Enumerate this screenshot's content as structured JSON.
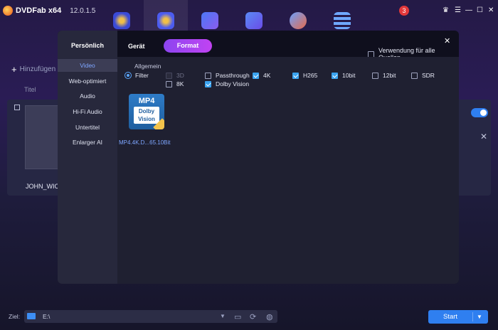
{
  "app": {
    "name": "DVDFab x64",
    "version": "12.0.1.5"
  },
  "top_icons": [
    "copy-disc-icon",
    "ripper-disc-icon",
    "video-converter-icon",
    "creator-icon",
    "utilities-rocket-icon",
    "task-queue-icon"
  ],
  "notification_count": "3",
  "background": {
    "add_label": "Hinzufügen",
    "title_column": "Titel",
    "item_name": "JOHN_WICK"
  },
  "modal": {
    "sidebar_title": "Persönlich",
    "sidebar_items": [
      "Video",
      "Web-optimiert",
      "Audio",
      "Hi-Fi Audio",
      "Untertitel",
      "Enlarger AI"
    ],
    "tabs": [
      "Gerät",
      "Format"
    ],
    "apply_all_label": "Verwendung für alle Quellen",
    "section_label": "Allgemein",
    "filter_label": "Filter",
    "options": [
      {
        "label": "3D",
        "checked": false,
        "disabled": true
      },
      {
        "label": "Passthrough",
        "checked": false,
        "disabled": false
      },
      {
        "label": "4K",
        "checked": true,
        "disabled": false
      },
      {
        "label": "H265",
        "checked": true,
        "disabled": false
      },
      {
        "label": "10bit",
        "checked": true,
        "disabled": false
      },
      {
        "label": "12bit",
        "checked": false,
        "disabled": false
      },
      {
        "label": "SDR",
        "checked": false,
        "disabled": false
      },
      {
        "label": "8K",
        "checked": false,
        "disabled": false
      },
      {
        "label": "Dolby Vision",
        "checked": true,
        "disabled": false
      }
    ],
    "profile": {
      "badge_top": "MP4",
      "badge_line1": "Dolby",
      "badge_line2": "Vision",
      "name": "MP4.4K.D...65.10Bit"
    }
  },
  "footer": {
    "ziel_label": "Ziel:",
    "path": "E:\\",
    "start_label": "Start"
  },
  "colors": {
    "accent": "#2f7ff0",
    "format_tab_start": "#8c45f0",
    "format_tab_end": "#c143f2",
    "badge": "#e2383a"
  }
}
